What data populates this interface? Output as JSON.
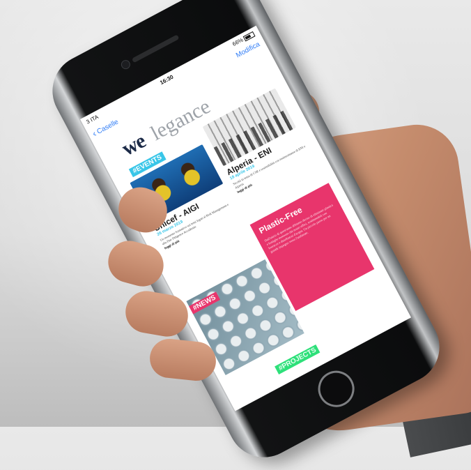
{
  "status_bar": {
    "carrier": "3 ITA",
    "time": "16:30",
    "battery": "66%"
  },
  "nav": {
    "back_label": "Caselle",
    "edit_label": "Modifica"
  },
  "email": {
    "logo": {
      "we": "we",
      "rest": "legance"
    },
    "events": {
      "tag": "#EVENTS",
      "cards": [
        {
          "title": "Unicef - AIGI",
          "date": "26 marzo 2019",
          "text": "Un momento formativo sui temi legati al Risk Management e alla Due Diligence Accademic",
          "more": "leggi di più"
        },
        {
          "title": "Alperia - ENI",
          "date": "18 aprile 2019",
          "text": "Siccità in tema di CSR e sostenibilità con testimonianze di ENI e Alperia",
          "more": "leggi di più"
        }
      ]
    },
    "news": {
      "tag": "#NEWS",
      "headline": "Plastic-Free",
      "text": "Dall'inizio di quest'anno abbiamo deciso di eliminare plastica e bottiglie monouso dai nostri uffici, sostituendoli con borracce e distributori d'acqua. Un piccolo passo per un grande impegno verso l'ambiente."
    },
    "projects": {
      "tag": "#PROJECTS"
    }
  }
}
